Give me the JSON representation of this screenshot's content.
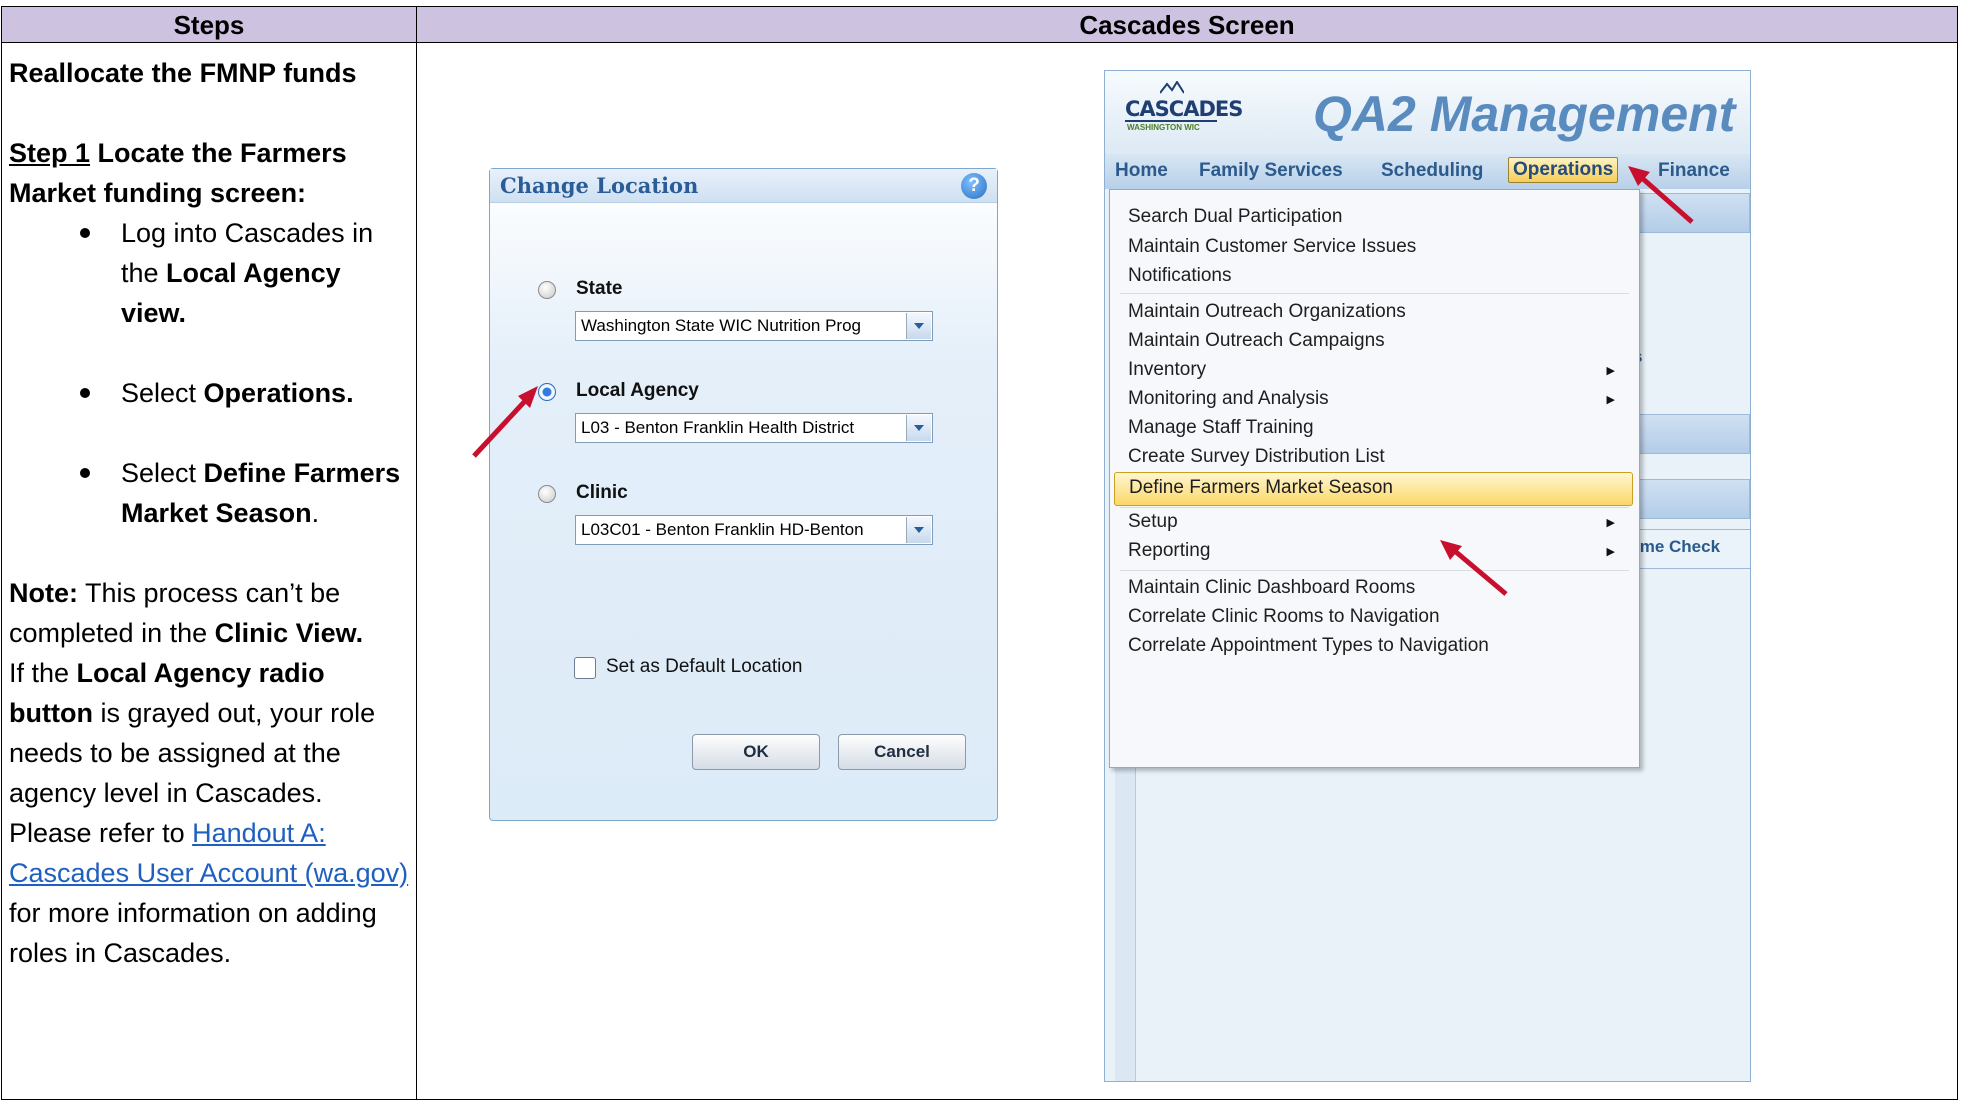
{
  "table": {
    "header_steps": "Steps",
    "header_screen": "Cascades Screen"
  },
  "steps": {
    "heading": "Reallocate the FMNP funds",
    "step1_prefix": "Step 1",
    "step1_text": " Locate the Farmers Market funding screen:",
    "bullets": [
      {
        "pre": "Log into Cascades in the ",
        "bold": "Local Agency view.",
        "post": ""
      },
      {
        "pre": "Select ",
        "bold": "Operations.",
        "post": ""
      },
      {
        "pre": "Select ",
        "bold": "Define Farmers Market Season",
        "post": "."
      }
    ],
    "note_label": "Note:",
    "note_text": " This process can’t be completed in the ",
    "note_bold": "Clinic View.",
    "if_text": "If the ",
    "if_bold": "Local Agency radio button",
    "if_rest": " is grayed out, your role needs to be assigned at the agency level in Cascades. Please refer to ",
    "link_text": "Handout A: Cascades User Account (wa.gov)",
    "after_link": " for more information on adding roles in Cascades."
  },
  "dialog": {
    "title": "Change Location",
    "options": [
      {
        "label": "State",
        "value": "Washington State WIC Nutrition Prog",
        "selected": false
      },
      {
        "label": "Local Agency",
        "value": "L03 - Benton Franklin Health District",
        "selected": true
      },
      {
        "label": "Clinic",
        "value": "L03C01 - Benton Franklin HD-Benton",
        "selected": false
      }
    ],
    "checkbox_label": "Set as Default Location",
    "ok_label": "OK",
    "cancel_label": "Cancel"
  },
  "app": {
    "logo_word": "CASCADES",
    "logo_sub": "WASHINGTON WIC",
    "title": "QA2 Management I",
    "menu": [
      "Home",
      "Family Services",
      "Scheduling",
      "Operations",
      "Finance"
    ],
    "active_menu": "Operations",
    "fragment_text": "ime  Check",
    "fragment_s": "s",
    "dropdown_items": [
      {
        "label": "Search Dual Participation",
        "submenu": false,
        "highlight": false
      },
      {
        "label": "Maintain Customer Service Issues",
        "submenu": false,
        "highlight": false
      },
      {
        "label": "Notifications",
        "submenu": false,
        "highlight": false
      },
      {
        "label": "Maintain Outreach Organizations",
        "submenu": false,
        "highlight": false
      },
      {
        "label": "Maintain Outreach Campaigns",
        "submenu": false,
        "highlight": false
      },
      {
        "label": "Inventory",
        "submenu": true,
        "highlight": false
      },
      {
        "label": "Monitoring and Analysis",
        "submenu": true,
        "highlight": false
      },
      {
        "label": "Manage Staff Training",
        "submenu": false,
        "highlight": false
      },
      {
        "label": "Create Survey Distribution List",
        "submenu": false,
        "highlight": false
      },
      {
        "label": "Define Farmers Market Season",
        "submenu": false,
        "highlight": true
      },
      {
        "label": "Setup",
        "submenu": true,
        "highlight": false
      },
      {
        "label": "Reporting",
        "submenu": true,
        "highlight": false
      },
      {
        "label": "Maintain Clinic Dashboard Rooms",
        "submenu": false,
        "highlight": false
      },
      {
        "label": "Correlate Clinic Rooms to Navigation",
        "submenu": false,
        "highlight": false
      },
      {
        "label": "Correlate Appointment Types to Navigation",
        "submenu": false,
        "highlight": false
      }
    ]
  },
  "colors": {
    "header_bg": "#cdc2e0",
    "link": "#1f5fbf",
    "arrow": "#c8102e",
    "highlight": "#fbd86a"
  }
}
